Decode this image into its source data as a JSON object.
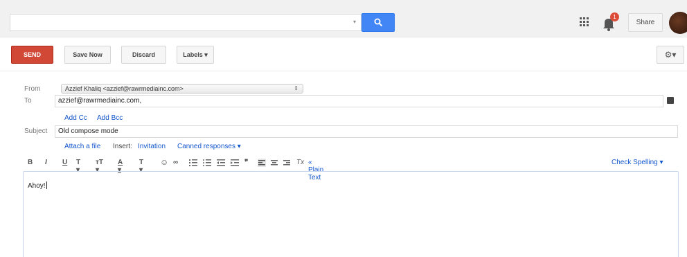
{
  "header": {
    "search_placeholder": "",
    "notification_count": "1",
    "share_label": "Share"
  },
  "toolbar": {
    "send_label": "SEND",
    "save_now_label": "Save Now",
    "discard_label": "Discard",
    "labels_label": "Labels ▾",
    "settings_label": "⚙▾"
  },
  "compose": {
    "from_label": "From",
    "from_value": "Azzief Khaliq <azzief@rawrmediainc.com>",
    "to_label": "To",
    "to_value": "azzief@rawrmediainc.com,",
    "add_cc": "Add Cc",
    "add_bcc": "Add Bcc",
    "subject_label": "Subject",
    "subject_value": "Old compose mode",
    "attach_file": "Attach a file",
    "insert_label": "Insert:",
    "invitation": "Invitation",
    "canned_responses": "Canned responses ▾",
    "plain_text": "« Plain Text",
    "check_spelling": "Check Spelling ▾",
    "body_text": "Ahoy!"
  },
  "formatting": {
    "bold": "B",
    "italic": "I",
    "underline": "U",
    "font": "T ▾",
    "size": "тT ▾",
    "text_color": "A ▾",
    "bg_color": "T ▾",
    "quote": "❞"
  },
  "colors": {
    "send": "#d14836",
    "search": "#4285f4",
    "link": "#1155cc",
    "badge": "#dd4b39"
  }
}
